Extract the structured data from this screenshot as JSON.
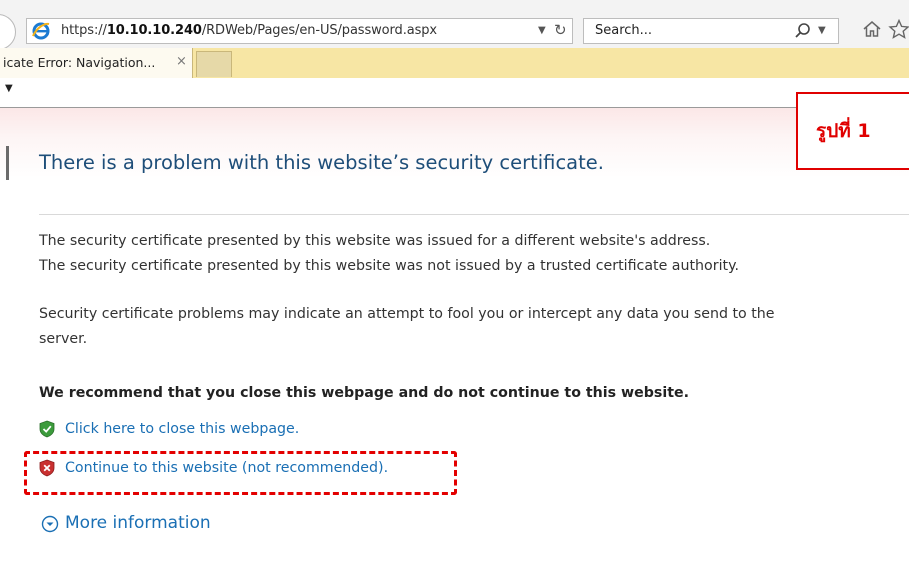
{
  "browser": {
    "url_prefix": "https://",
    "url_host": "10.10.10.240",
    "url_path": "/RDWeb/Pages/en-US/password.aspx",
    "search_placeholder": "Search...",
    "tab_label": "icate Error: Navigation...",
    "tab_close": "×",
    "accent_color": "#f7e6a4",
    "icons": [
      "ie-logo-icon",
      "refresh-icon",
      "search-icon",
      "home-icon",
      "favorites-star-icon",
      "close-icon"
    ]
  },
  "page": {
    "heading": "There is a problem with this website’s security certificate.",
    "lines": [
      "The security certificate presented by this website was issued for a different website's address.",
      "The security certificate presented by this website was not issued by a trusted certificate authority.",
      "Security certificate problems may indicate an attempt to fool you or intercept any data you send to the",
      "server."
    ],
    "recommendation": "We recommend that you close this webpage and do not continue to this website.",
    "close_link": "Click here to close this webpage.",
    "continue_link": "Continue to this website (not recommended).",
    "more_info": "More information",
    "link_color": "#1a6fb4",
    "heading_color": "#1e4e79"
  },
  "annotation": {
    "label": "รูปที่ 1",
    "color": "#e00000"
  }
}
